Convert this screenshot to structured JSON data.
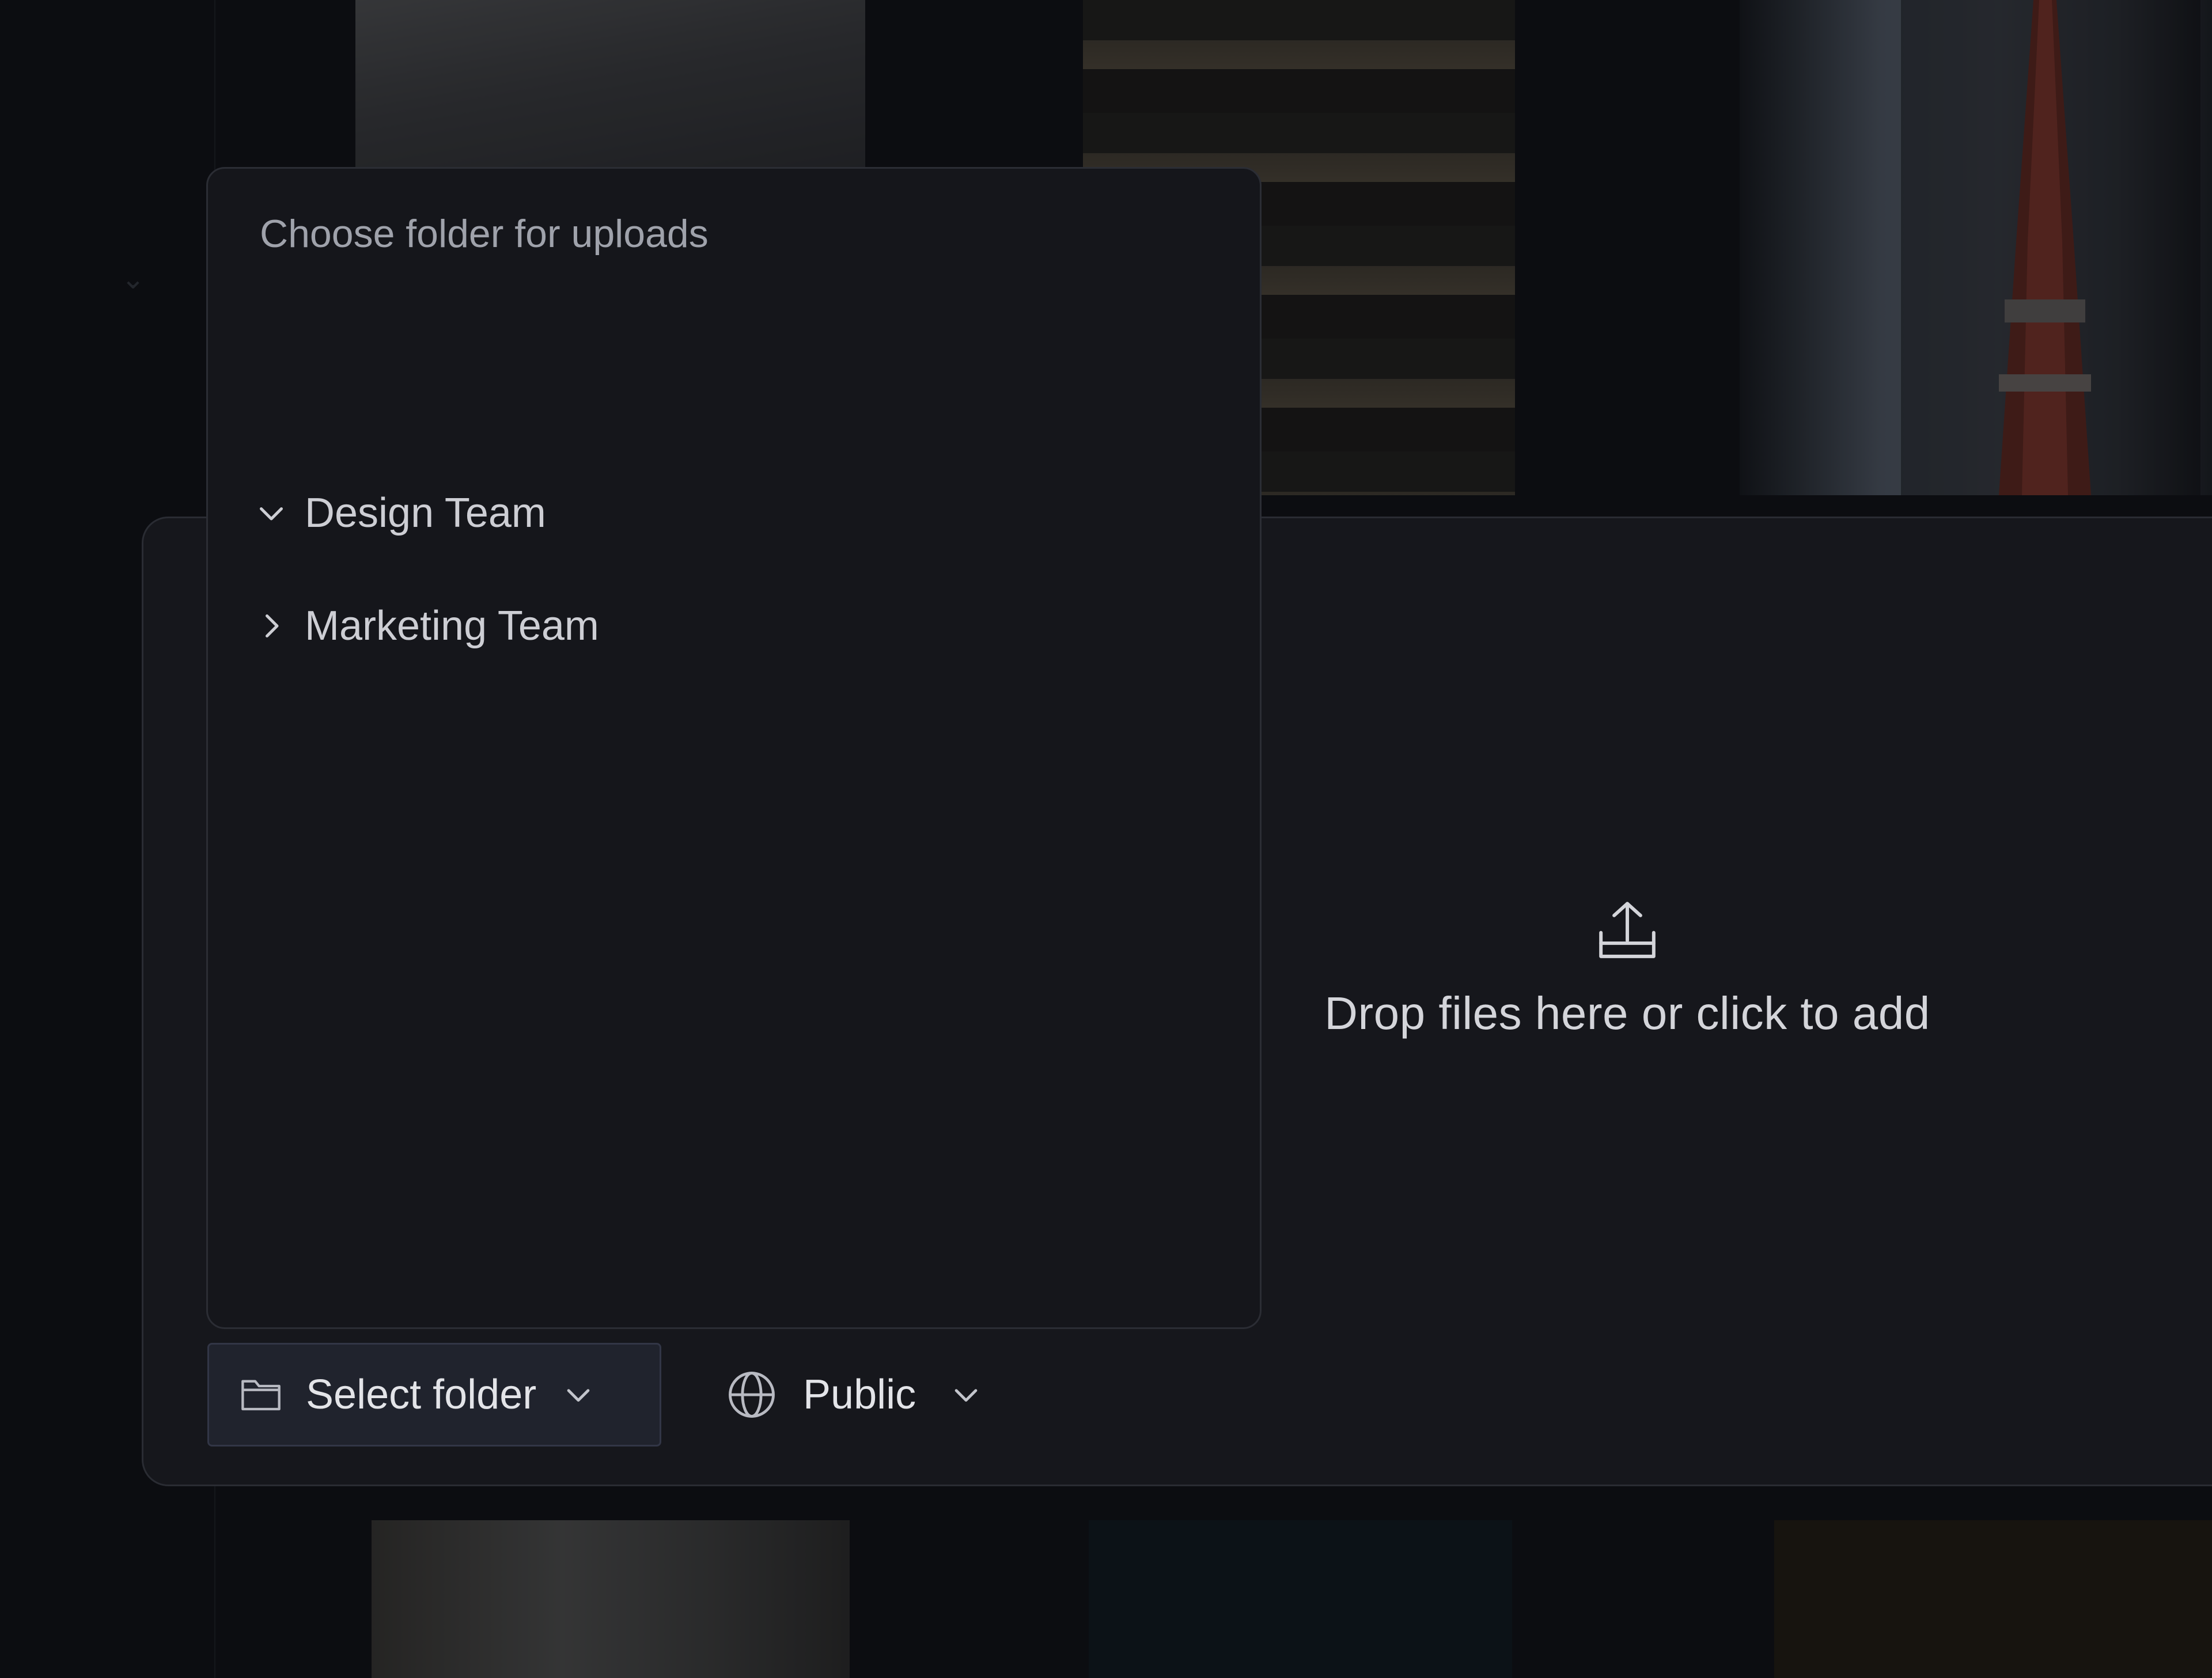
{
  "folder_picker": {
    "title": "Choose folder for uploads",
    "folders": [
      {
        "label": "Design Team",
        "expanded": true,
        "icon": "chevron-down-icon"
      },
      {
        "label": "Marketing Team",
        "expanded": false,
        "icon": "chevron-right-icon"
      }
    ]
  },
  "drop_zone": {
    "icon": "upload-icon",
    "text": "Drop files here or click to add"
  },
  "toolbar": {
    "select_folder": {
      "label": "Select folder",
      "icon": "folder-icon"
    },
    "visibility": {
      "label": "Public",
      "icon": "globe-icon"
    }
  },
  "colors": {
    "panel_bg": "#16171c",
    "popover_bg": "#15161b",
    "button_bg": "#20232d",
    "text_primary": "#e3e4e8",
    "text_muted": "#9fa2ab"
  }
}
